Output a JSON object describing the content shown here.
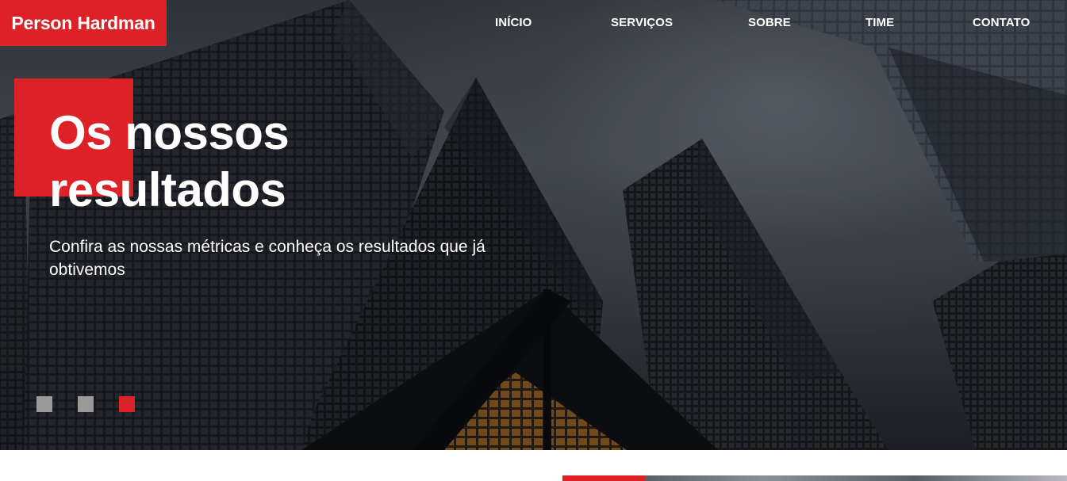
{
  "brand": {
    "name": "Person Hardman"
  },
  "nav": {
    "items": [
      {
        "label": "INÍCIO"
      },
      {
        "label": "SERVIÇOS"
      },
      {
        "label": "SOBRE"
      },
      {
        "label": "TIME"
      },
      {
        "label": "CONTATO"
      }
    ]
  },
  "hero": {
    "title": "Os nossos resultados",
    "subtitle": "Confira as nossas métricas e conheça os resultados que já obtivemos"
  },
  "carousel": {
    "slide_count": 3,
    "active_index": 2
  },
  "colors": {
    "accent": "#dc2226",
    "indicator_inactive": "#9a9a9a",
    "text_on_hero": "#ffffff"
  }
}
